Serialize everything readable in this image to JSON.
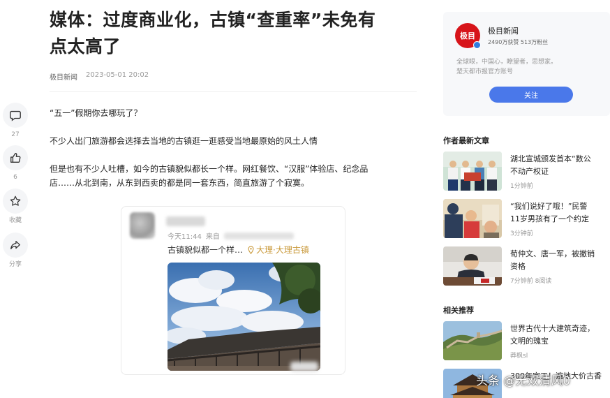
{
  "article": {
    "title_line1": "媒体：过度商业化，古镇“查重率”未免有",
    "title_line2": "点太高了",
    "source": "极目新闻",
    "time": "2023-05-01 20:02",
    "paragraphs": [
      "“五一”假期你去哪玩了？",
      "不少人出门旅游都会选择去当地的古镇逛一逛感受当地最原始的风土人情",
      "但是也有不少人吐槽，如今的古镇貌似都长一个样。网红餐饮、“汉服”体验店、纪念品",
      "店……从北到南，从东到西卖的都是同一套东西，简直旅游了个寂寞。"
    ]
  },
  "rail": {
    "comment": {
      "icon": "comment-icon",
      "count": "27"
    },
    "like": {
      "icon": "thumbs-up-icon",
      "count": "6"
    },
    "favorite": {
      "icon": "star-icon",
      "label": "收藏"
    },
    "share": {
      "icon": "share-icon",
      "label": "分享"
    }
  },
  "post": {
    "time": "今天11:44",
    "from_label": "来自",
    "text": "古镇貌似都一个样…",
    "location": "大理·大理古镇"
  },
  "author": {
    "logo_text": "极目",
    "name": "极目新闻",
    "stats": "2490万获赞 513万粉丝",
    "desc_line1": "全球眼，中国心，瞭望者，思想家。",
    "desc_line2": "楚天都市报官方账号",
    "follow_label": "关注"
  },
  "latest": {
    "title": "作者最新文章",
    "items": [
      {
        "line1": "湖北宣城颁发首本“数公",
        "line2": "不动产权证",
        "meta": "1分钟前"
      },
      {
        "line1": "“我们说好了哦！”民警",
        "line2": "11岁男孩有了一个约定",
        "meta": "3分钟前"
      },
      {
        "line1": "荀仲文、唐一军，被撤销",
        "line2": "资格",
        "meta": "7分钟前  8阅读"
      }
    ]
  },
  "related": {
    "title": "相关推荐",
    "items": [
      {
        "line1": "世界古代十大建筑奇迹，",
        "line2": "文明的瑰宝",
        "meta": "莽枫sl"
      },
      {
        "line1": "300年完工！遍地大价古香",
        "line2": "",
        "meta": ""
      }
    ]
  },
  "watermark": "头条 @无双清风0",
  "colors": {
    "accent": "#4a78ea",
    "brand_red": "#d7141a",
    "location": "#c9993a"
  }
}
